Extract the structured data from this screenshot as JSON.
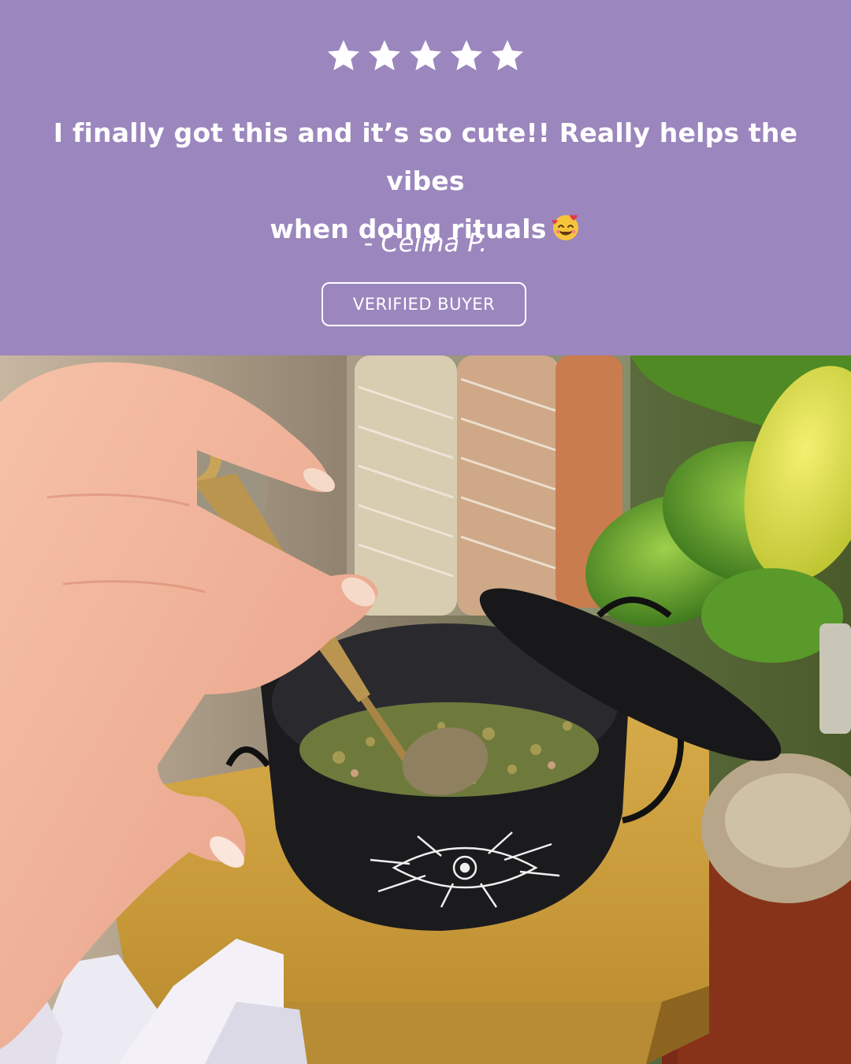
{
  "review": {
    "rating": 5,
    "rating_max": 5,
    "quote_line1": "I finally got this and it’s so cute!! Really helps the vibes",
    "quote_line2": "when doing rituals",
    "emoji": "smiling-face-with-hearts-icon",
    "author": "- Celina P.",
    "badge": "VERIFIED BUYER"
  },
  "colors": {
    "panel_bg": "#9b86bd",
    "text": "#ffffff"
  },
  "photo": {
    "subject": "hand holding brass spoon over black cauldron of dried herbs"
  }
}
